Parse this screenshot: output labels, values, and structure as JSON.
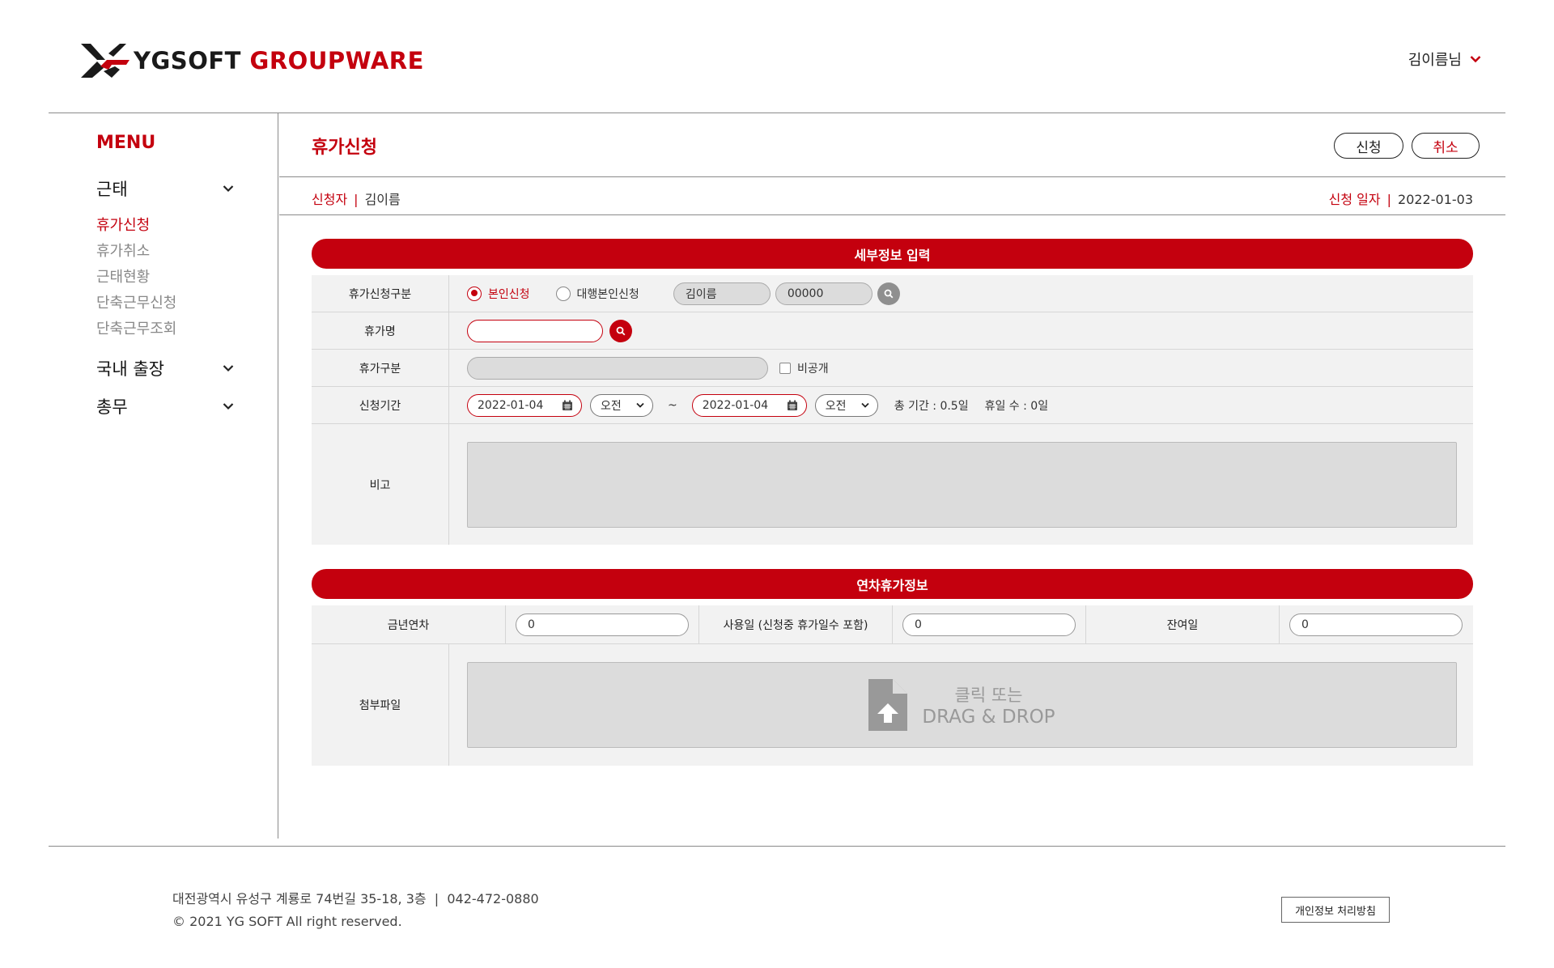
{
  "header": {
    "logo_text_a": "YGSOFT",
    "logo_text_b": "GROUPWARE",
    "user_name": "김이름님"
  },
  "sidebar": {
    "menu_title": "MENU",
    "categories": [
      {
        "label": "근태",
        "items": [
          "휴가신청",
          "휴가취소",
          "근태현황",
          "단축근무신청",
          "단축근무조회"
        ]
      },
      {
        "label": "국내 출장"
      },
      {
        "label": "총무"
      }
    ],
    "active_item": "휴가신청"
  },
  "main": {
    "title": "휴가신청",
    "apply_button": "신청",
    "cancel_button": "취소",
    "applicant_label": "신청자",
    "applicant_name": "김이름",
    "date_label": "신청 일자",
    "date_value": "2022-01-03",
    "separator": "|"
  },
  "detail": {
    "section_title": "세부정보 입력",
    "type_label": "휴가신청구분",
    "radio_self": "본인신청",
    "radio_proxy": "대행본인신청",
    "proxy_name": "김이름",
    "proxy_code": "00000",
    "leave_name_label": "휴가명",
    "leave_name_value": "",
    "leave_kind_label": "휴가구분",
    "leave_kind_value": "",
    "private_label": "비공개",
    "period_label": "신청기간",
    "start_date": "2022-01-04",
    "start_ampm": "오전",
    "tilde": "~",
    "end_date": "2022-01-04",
    "end_ampm": "오전",
    "total_period": "총 기간 : 0.5일",
    "holidays": "휴일 수 : 0일",
    "remark_label": "비고"
  },
  "annual": {
    "section_title": "연차휴가정보",
    "this_year_label": "금년연차",
    "this_year_value": "0",
    "used_label": "사용일 (신청중 휴가일수 포함)",
    "used_value": "0",
    "remaining_label": "잔여일",
    "remaining_value": "0",
    "attach_label": "첨부파일",
    "dropzone_line1": "클릭 또는",
    "dropzone_line2": "DRAG & DROP"
  },
  "footer": {
    "address": "대전광역시 유성구 계룡로 74번길 35-18, 3층  |  042-472-0880",
    "copyright": "© 2021 YG SOFT All right reserved.",
    "privacy_button": "개인정보 처리방침"
  },
  "colors": {
    "accent": "#c4000e",
    "panel": "#f2f2f2",
    "field": "#dcdcdc"
  },
  "icons": [
    "logo-icon",
    "chevron-down-icon",
    "search-icon",
    "calendar-icon",
    "upload-file-icon"
  ]
}
